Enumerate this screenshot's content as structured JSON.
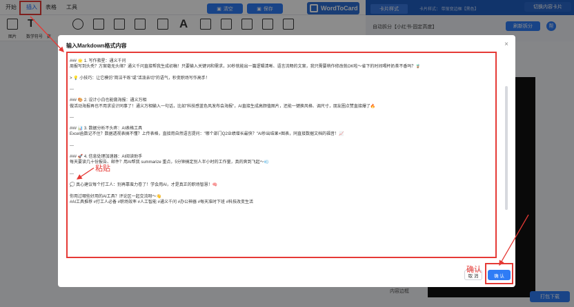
{
  "menu": {
    "tabs": [
      "开始",
      "插入",
      "表格",
      "工具"
    ],
    "clear_label": "清空",
    "save_label": "保存"
  },
  "logo": {
    "text": "WordToCard"
  },
  "right_header": {
    "card_style_label": "卡片样式",
    "style_info": "卡片样式：  带渐变边框【黑色】",
    "switch_label": "切换内容卡片"
  },
  "toolbar2": {
    "labels": [
      "图片",
      "数学符号",
      "数"
    ]
  },
  "right_bar2": {
    "mode_label": "自动拆分【小红书-固定高度】",
    "resplit_label": "刷新拆分",
    "help": "帮"
  },
  "bottom": {
    "word": "内容边框",
    "print_label": "打包下载"
  },
  "modal": {
    "title": "输入Markdown格式内容",
    "close": "×",
    "cancel_label": "取 消",
    "confirm_label": "确 认",
    "lines": [
      "### 🌟 1. 写作救星：通义千问",
      "周报写到头秃？方案毫无头绪？通义千问直接帮我生成初稿！只要输入关键词和需求，30秒就能出一篇逻辑清晰、语言流畅的文案，我只需要稍作修改就OK啦～省下的时间喝杯奶茶不香吗？🧋",
      "",
      "> 💡 小技巧：让它模仿\"简洁干练\"或\"活泼亲切\"的语气，秒变职场写作高手！",
      "",
      "---",
      "",
      "### 🎨 2. 设计小白也能做海报：通义万相",
      "做活动海报再也不用求设计同事了！通义万相输入一句话，比如\"科技感蓝色风发布会海报\"，AI直接生成高颜值图片，还能一键换风格、调尺寸，朋友圈点赞直接爆了🔥",
      "",
      "---",
      "",
      "### 📊 3. 数据分析不头疼：AI表格工具",
      "Excel函数记不住？数据透视表搞不懂？上传表格，直接用自然语言提问：\"哪个部门Q2业绩增长最快？\"AI秒出结果+图表，同直接数据文档的福音！📈",
      "",
      "---",
      "",
      "### 🚀 4. 信息处理加速器：AI阅读助手",
      "每天要读几十份报告、邮件？用AI帮我 summarize 重点，5分钟搞定别人半小时的工作量，真的爽到飞起～💨",
      "",
      "---",
      "",
      "💭 真心建议每个打工人：别再靠蛮力卷了！学会用AI，才是真正的职场智慧！🧠",
      "",
      "你用过哪些好用的AI工具？评论区一起交流呀～👋",
      "#AI工具推荐 #打工人必备 #职场效率 #人工智能 #通义千问 #办公神器 #每天准时下班 #科技改变生活"
    ]
  },
  "annotations": {
    "paste": "粘贴",
    "confirm": "确认"
  }
}
